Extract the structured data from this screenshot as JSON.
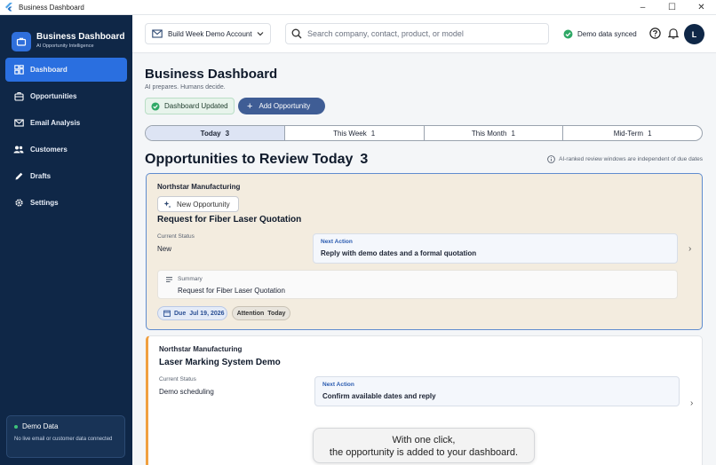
{
  "window": {
    "title": "Business Dashboard",
    "controls": [
      "–",
      "☐",
      "✕"
    ]
  },
  "sidebar": {
    "brand_title": "Business Dashboard",
    "brand_subtitle": "AI Opportunity Intelligence",
    "items": [
      {
        "label": "Dashboard",
        "icon": "dashboard-icon",
        "active": true
      },
      {
        "label": "Opportunities",
        "icon": "briefcase-icon",
        "active": false
      },
      {
        "label": "Email Analysis",
        "icon": "mail-icon",
        "active": false
      },
      {
        "label": "Customers",
        "icon": "people-icon",
        "active": false
      },
      {
        "label": "Drafts",
        "icon": "pencil-icon",
        "active": false
      },
      {
        "label": "Settings",
        "icon": "gear-icon",
        "active": false
      }
    ],
    "demo": {
      "title": "Demo Data",
      "description": "No live email or customer data connected"
    }
  },
  "topbar": {
    "account": "Build Week Demo Account",
    "search_placeholder": "Search company, contact, product, or model",
    "sync_status": "Demo data synced",
    "avatar_initial": "L"
  },
  "main": {
    "title": "Business Dashboard",
    "subtitle": "AI prepares. Humans decide.",
    "updated_label": "Dashboard Updated",
    "add_label": "Add Opportunity",
    "tabs": [
      {
        "label": "Today",
        "count": "3",
        "active": true
      },
      {
        "label": "This Week",
        "count": "1",
        "active": false
      },
      {
        "label": "This Month",
        "count": "1",
        "active": false
      },
      {
        "label": "Mid-Term",
        "count": "1",
        "active": false
      }
    ],
    "section_title": "Opportunities to Review Today",
    "section_count": "3",
    "section_note": "AI-ranked review windows are independent of due dates",
    "cards": [
      {
        "company": "Northstar Manufacturing",
        "tag": "New Opportunity",
        "title": "Request for Fiber Laser Quotation",
        "status_label": "Current Status",
        "status": "New",
        "next_label": "Next Action",
        "next_action": "Reply with demo dates and a formal quotation",
        "summary_label": "Summary",
        "summary": "Request for Fiber Laser Quotation",
        "due_label": "Due",
        "due_date": "Jul 19, 2026",
        "attention_label": "Attention",
        "attention_value": "Today"
      },
      {
        "company": "Northstar Manufacturing",
        "title": "Laser Marking System Demo",
        "status_label": "Current Status",
        "status": "Demo scheduling",
        "next_label": "Next Action",
        "next_action": "Confirm available dates and reply"
      }
    ]
  },
  "toast": {
    "line1": "With one click,",
    "line2": "the opportunity is added to your dashboard."
  },
  "colors": {
    "sidebar": "#0f2747",
    "accent": "#2a6fe0",
    "success": "#3dc37a",
    "card_highlight": "#f3ecdf",
    "card_border": "#5f8ccf"
  }
}
